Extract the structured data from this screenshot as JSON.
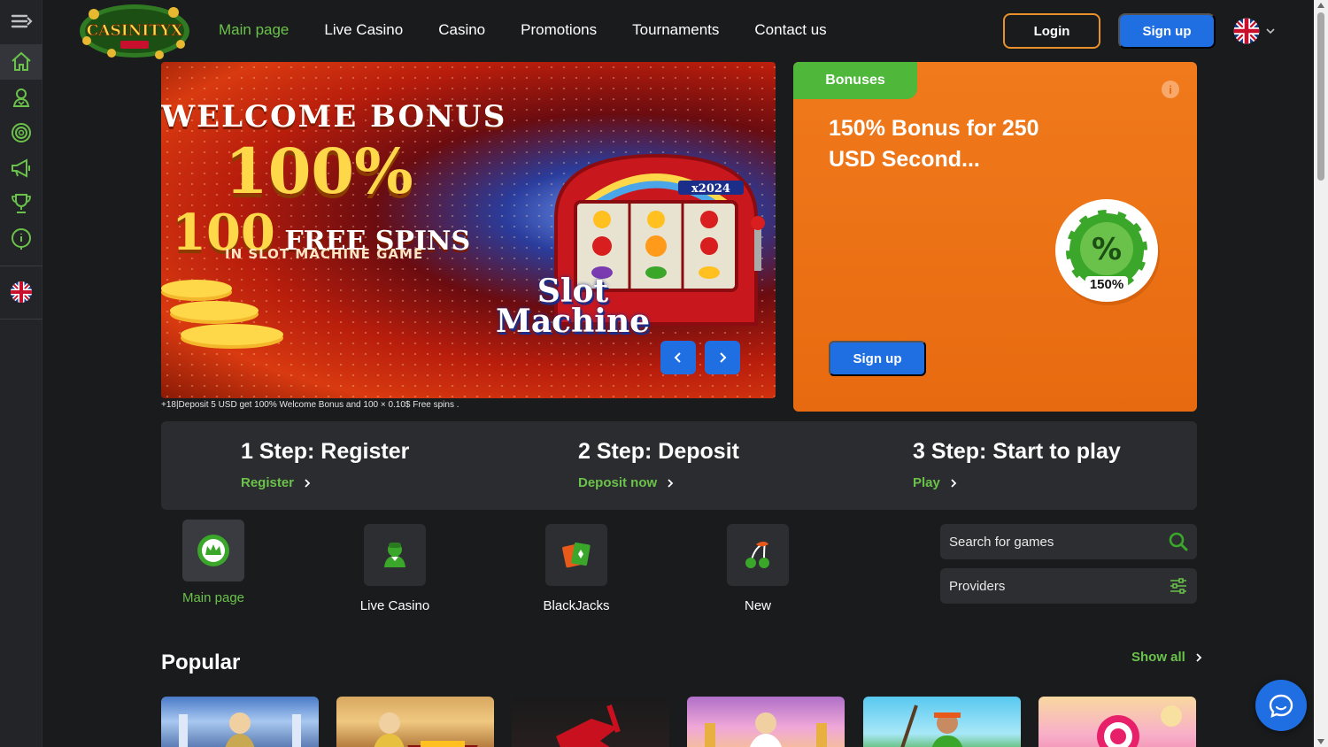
{
  "header": {
    "logo_alt": "CASINITYX",
    "nav": [
      "Main page",
      "Live Casino",
      "Casino",
      "Promotions",
      "Tournaments",
      "Contact us"
    ],
    "login_label": "Login",
    "signup_label": "Sign up",
    "language": "English (UK flag)"
  },
  "sidebar": {
    "items": [
      "menu-toggle",
      "home",
      "live-casino",
      "casino",
      "promotions",
      "tournaments",
      "info",
      "language"
    ]
  },
  "banner": {
    "title": "WELCOME BONUS",
    "percent": "100%",
    "spins_count": "100",
    "spins_text": "FREE SPINS",
    "subtitle": "IN SLOT MACHINE GAME",
    "badge": "x2024",
    "machine_title_1": "Slot",
    "machine_title_2": "Machine",
    "note": "+18|Deposit 5 USD get 100% Welcome Bonus and 100 × 0.10$ Free spins ."
  },
  "bonus": {
    "tab": "Bonuses",
    "info": "i",
    "text": "150% Bonus for 250 USD Second...",
    "chip_label": "150%",
    "chip_symbol": "%",
    "button": "Sign up"
  },
  "steps": [
    {
      "title": "1 Step: Register",
      "link": "Register"
    },
    {
      "title": "2 Step: Deposit",
      "link": "Deposit now"
    },
    {
      "title": "3 Step: Start to play",
      "link": "Play"
    }
  ],
  "categories": [
    {
      "label": "Main page"
    },
    {
      "label": "Live Casino"
    },
    {
      "label": "BlackJacks"
    },
    {
      "label": "New"
    }
  ],
  "search": {
    "placeholder": "Search for games"
  },
  "providers": {
    "label": "Providers"
  },
  "popular": {
    "title": "Popular",
    "show_all": "Show all"
  },
  "colors": {
    "accent_green": "#6bc24a",
    "primary_blue": "#1f6fe3",
    "orange": "#e86a10",
    "login_border": "#e8912a"
  }
}
